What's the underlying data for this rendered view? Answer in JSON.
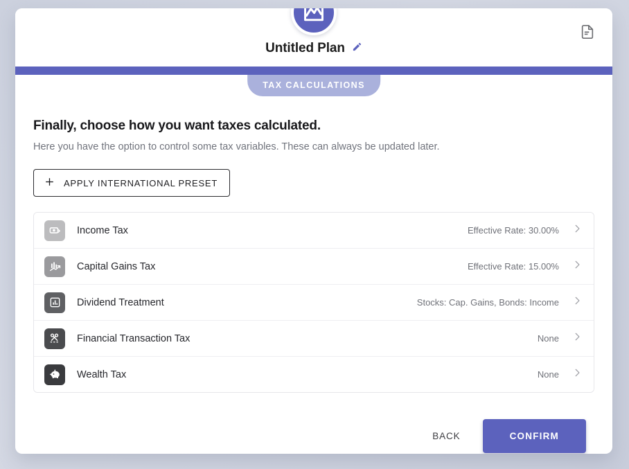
{
  "header": {
    "logo_icon": "chart-line-logo-icon",
    "plan_title": "Untitled Plan",
    "edit_icon": "pencil-edit-icon",
    "document_icon": "document-icon",
    "accent_color": "#5c62bd"
  },
  "progress": {
    "percent": 100,
    "track_color": "#e9eaf4",
    "fill_color": "#5c62bd"
  },
  "stage": {
    "label": "TAX CALCULATIONS",
    "badge_color": "#aab1dc"
  },
  "main": {
    "heading": "Finally, choose how you want taxes calculated.",
    "subheading": "Here you have the option to control some tax variables. These can always be updated later.",
    "preset_button": {
      "label": "APPLY INTERNATIONAL PRESET",
      "icon": "plus-icon"
    },
    "tax_rows": [
      {
        "label": "Income Tax",
        "value": "Effective Rate: 30.00%",
        "icon": "money-exchange-icon",
        "icon_bg": "#bcbcbe"
      },
      {
        "label": "Capital Gains Tax",
        "value": "Effective Rate: 15.00%",
        "icon": "growth-chart-icon",
        "icon_bg": "#9a9a9d"
      },
      {
        "label": "Dividend Treatment",
        "value": "Stocks: Cap. Gains, Bonds: Income",
        "icon": "bar-chart-icon",
        "icon_bg": "#5f6063"
      },
      {
        "label": "Financial Transaction Tax",
        "value": "None",
        "icon": "scissors-icon",
        "icon_bg": "#4a4b4e"
      },
      {
        "label": "Wealth Tax",
        "value": "None",
        "icon": "piggy-bank-icon",
        "icon_bg": "#3a3b3e"
      }
    ]
  },
  "footer": {
    "back_label": "BACK",
    "confirm_label": "CONFIRM",
    "confirm_color": "#5c62bd"
  }
}
